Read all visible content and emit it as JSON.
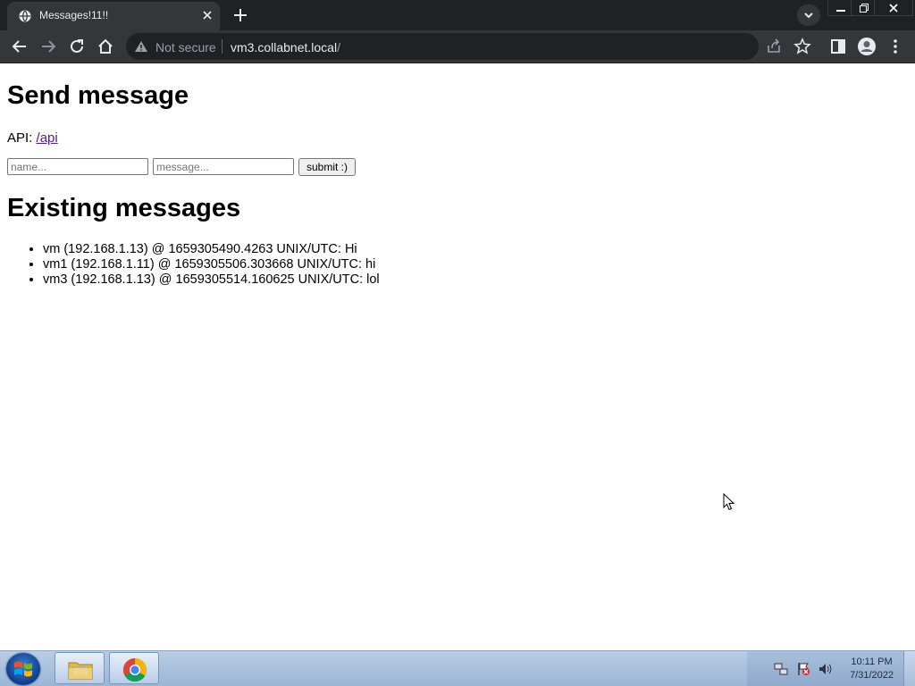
{
  "browser": {
    "tab_title": "Messages!11!!",
    "security_text": "Not secure",
    "url_host": "vm3.collabnet.local",
    "url_path": "/"
  },
  "page": {
    "send_heading": "Send message",
    "api_label": "API:",
    "api_link_text": "/api",
    "name_placeholder": "name...",
    "message_placeholder": "message...",
    "submit_label": "submit :)",
    "existing_heading": "Existing messages",
    "messages": [
      "vm (192.168.1.13) @ 1659305490.4263 UNIX/UTC: Hi",
      "vm1 (192.168.1.11) @ 1659305506.303668 UNIX/UTC: hi",
      "vm3 (192.168.1.13) @ 1659305514.160625 UNIX/UTC: lol"
    ]
  },
  "taskbar": {
    "time": "10:11 PM",
    "date": "7/31/2022",
    "apps": [
      "windows-explorer",
      "google-chrome"
    ]
  },
  "colors": {
    "chrome_frame": "#202124",
    "chrome_toolbar": "#35363a",
    "visited_link": "#551a8b"
  }
}
